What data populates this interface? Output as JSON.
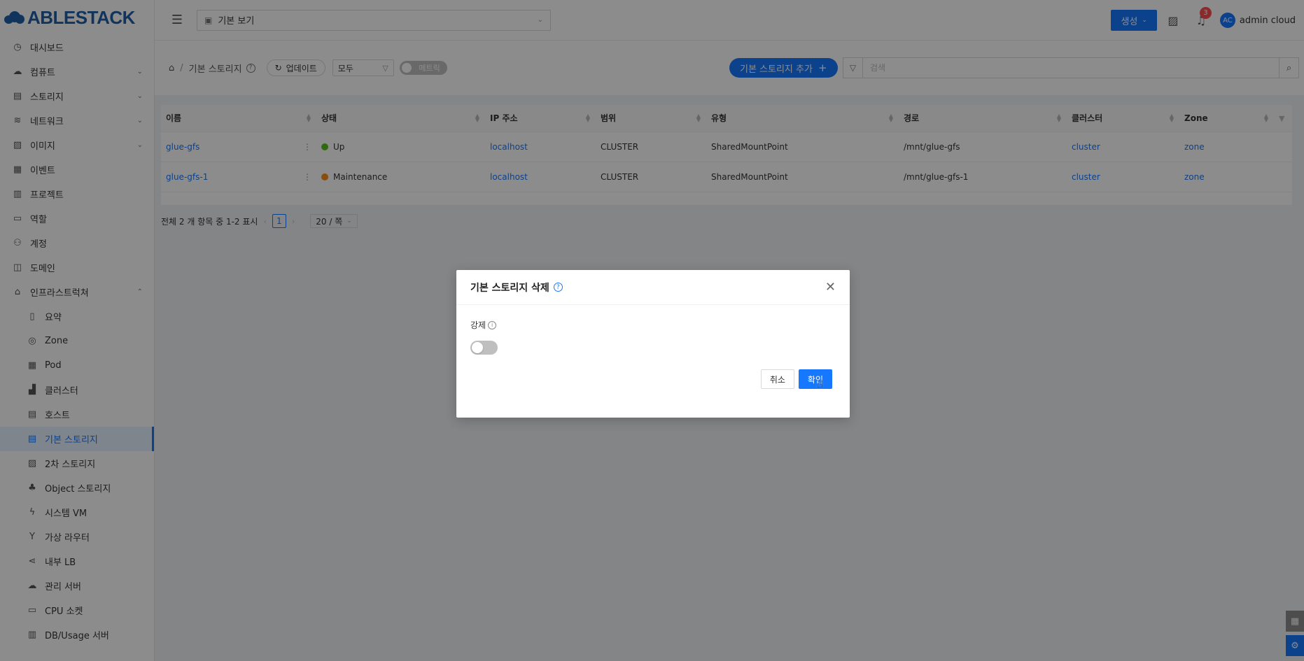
{
  "brand": {
    "logo_text": "ABLESTACK"
  },
  "sidebar": {
    "items": [
      {
        "label": "대시보드",
        "icon": "dashboard-icon",
        "glyph": "◷"
      },
      {
        "label": "컴퓨트",
        "icon": "cloud-icon",
        "glyph": "☁",
        "chevron": "⌄"
      },
      {
        "label": "스토리지",
        "icon": "database-icon",
        "glyph": "▤",
        "chevron": "⌄"
      },
      {
        "label": "네트워크",
        "icon": "wifi-icon",
        "glyph": "≋",
        "chevron": "⌄"
      },
      {
        "label": "이미지",
        "icon": "picture-icon",
        "glyph": "▨",
        "chevron": "⌄"
      },
      {
        "label": "이벤트",
        "icon": "schedule-icon",
        "glyph": "▦"
      },
      {
        "label": "프로젝트",
        "icon": "project-icon",
        "glyph": "▥"
      },
      {
        "label": "역할",
        "icon": "id-card-icon",
        "glyph": "▭"
      },
      {
        "label": "계정",
        "icon": "team-icon",
        "glyph": "⚇"
      },
      {
        "label": "도메인",
        "icon": "block-icon",
        "glyph": "◫"
      },
      {
        "label": "인프라스트럭쳐",
        "icon": "bank-icon",
        "glyph": "⌂",
        "chevron": "⌃"
      }
    ],
    "sub_items": [
      {
        "label": "요약",
        "icon": "read-icon",
        "glyph": "▯"
      },
      {
        "label": "Zone",
        "icon": "global-icon",
        "glyph": "◎"
      },
      {
        "label": "Pod",
        "icon": "appstore-icon",
        "glyph": "▦"
      },
      {
        "label": "클러스터",
        "icon": "cluster-icon",
        "glyph": "▟"
      },
      {
        "label": "호스트",
        "icon": "host-icon",
        "glyph": "▤"
      },
      {
        "label": "기본 스토리지",
        "icon": "primary-storage-icon",
        "glyph": "▤",
        "active": true
      },
      {
        "label": "2차 스토리지",
        "icon": "picture-icon",
        "glyph": "▨"
      },
      {
        "label": "Object 스토리지",
        "icon": "gold-icon",
        "glyph": "♣"
      },
      {
        "label": "시스템 VM",
        "icon": "thunderbolt-icon",
        "glyph": "ϟ"
      },
      {
        "label": "가상 라우터",
        "icon": "fork-icon",
        "glyph": "Y"
      },
      {
        "label": "내부 LB",
        "icon": "share-icon",
        "glyph": "⋖"
      },
      {
        "label": "관리 서버",
        "icon": "cloud-server-icon",
        "glyph": "☁"
      },
      {
        "label": "CPU 소켓",
        "icon": "inbox-icon",
        "glyph": "▭"
      },
      {
        "label": "DB/Usage 서버",
        "icon": "bar-chart-icon",
        "glyph": "▥"
      }
    ]
  },
  "header": {
    "view_select": "기본 보기",
    "create_label": "생성",
    "notification_count": "3",
    "avatar_initials": "AC",
    "user_name": "admin cloud"
  },
  "toolbar": {
    "breadcrumb_home": "⌂",
    "breadcrumb_sep": "/",
    "breadcrumb_current": "기본 스토리지",
    "refresh_label": "업데이트",
    "filter_value": "모두",
    "metric_label": "메트릭",
    "add_label": "기본 스토리지 추가",
    "search_placeholder": "검색"
  },
  "table": {
    "columns": [
      "이름",
      "상태",
      "IP 주소",
      "범위",
      "유형",
      "경로",
      "클러스터",
      "Zone"
    ],
    "rows": [
      {
        "name": "glue-gfs",
        "state": "Up",
        "state_color": "#52c41a",
        "ip": "localhost",
        "scope": "CLUSTER",
        "type": "SharedMountPoint",
        "path": "/mnt/glue-gfs",
        "cluster": "cluster",
        "zone": "zone"
      },
      {
        "name": "glue-gfs-1",
        "state": "Maintenance",
        "state_color": "#fa8c16",
        "ip": "localhost",
        "scope": "CLUSTER",
        "type": "SharedMountPoint",
        "path": "/mnt/glue-gfs-1",
        "cluster": "cluster",
        "zone": "zone"
      }
    ]
  },
  "pagination": {
    "summary": "전체 2 개 항목 중 1-2 표시",
    "current_page": "1",
    "page_size": "20 / 쪽"
  },
  "modal": {
    "title": "기본 스토리지 삭제",
    "force_label": "강제",
    "force_enabled": false,
    "cancel_label": "취소",
    "ok_label": "확인"
  },
  "colors": {
    "accent": "#1677ff",
    "brand": "#1f5fa8"
  }
}
